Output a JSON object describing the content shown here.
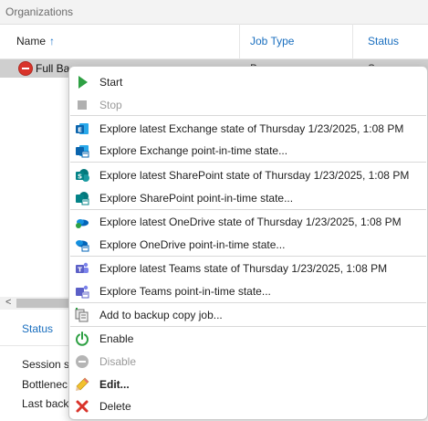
{
  "panel": {
    "title": "Organizations"
  },
  "columns": {
    "name": "Name",
    "sort_arrow": "↑",
    "job_type": "Job Type",
    "status": "Status"
  },
  "row": {
    "name": "Full Bac",
    "job_type": "B",
    "status": "S"
  },
  "bottom": {
    "status_tab": "Status",
    "session": "Session st",
    "bottleneck": "Bottlenec",
    "last_backup": "Last backu",
    "scroll_left": "<"
  },
  "menu": {
    "start": "Start",
    "stop": "Stop",
    "explore_exchange_latest": "Explore latest Exchange state of Thursday 1/23/2025, 1:08 PM",
    "explore_exchange_pit": "Explore Exchange point-in-time state...",
    "explore_sharepoint_latest": "Explore latest SharePoint state of Thursday 1/23/2025, 1:08 PM",
    "explore_sharepoint_pit": "Explore SharePoint point-in-time state...",
    "explore_onedrive_latest": "Explore latest OneDrive state of Thursday 1/23/2025, 1:08 PM",
    "explore_onedrive_pit": "Explore OneDrive point-in-time state...",
    "explore_teams_latest": "Explore latest Teams state of Thursday 1/23/2025, 1:08 PM",
    "explore_teams_pit": "Explore Teams point-in-time state...",
    "add_to_copy_job": "Add to backup copy job...",
    "enable": "Enable",
    "disable": "Disable",
    "edit": "Edit...",
    "delete": "Delete"
  },
  "colors": {
    "accent_blue": "#1a6fbf",
    "start_green": "#2ea043",
    "delete_red": "#d9342b",
    "exchange_blue": "#0a64ad",
    "sharepoint_teal": "#038387",
    "onedrive_blue": "#0364b8",
    "teams_purple": "#5b5fc7"
  }
}
